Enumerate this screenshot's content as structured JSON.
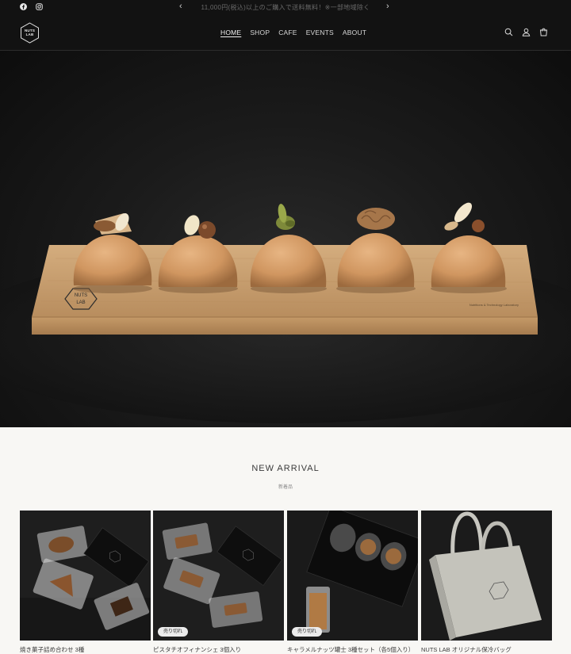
{
  "announcement": {
    "message": "11,000円(税込)以上のご購入で送料無料！※一部地域除く",
    "prev_arrow": "‹",
    "next_arrow": "›"
  },
  "social": [
    "facebook-icon",
    "instagram-icon"
  ],
  "header": {
    "logo_lines": [
      "NUTS",
      "LAB"
    ],
    "nav": [
      {
        "label": "HOME",
        "active": true
      },
      {
        "label": "SHOP",
        "active": false
      },
      {
        "label": "CAFE",
        "active": false
      },
      {
        "label": "EVENTS",
        "active": false
      },
      {
        "label": "ABOUT",
        "active": false
      }
    ],
    "icons": [
      "search-icon",
      "account-icon",
      "cart-icon"
    ]
  },
  "hero": {
    "board_brand": "NUTS LAB",
    "board_text": "Nutritions & Technology Laboratory"
  },
  "new_arrival": {
    "title": "NEW ARRIVAL",
    "subtitle": "新着品",
    "products": [
      {
        "name": "焼き菓子詰め合わせ 3種",
        "badge": ""
      },
      {
        "name": "ピスタチオフィナンシェ 3個入り",
        "badge": "売り切れ"
      },
      {
        "name": "キャラメルナッツ罐士 3種セット（各5個入り）",
        "badge": "売り切れ"
      },
      {
        "name": "NUTS LAB オリジナル保冷バッグ",
        "badge": ""
      }
    ]
  },
  "colors": {
    "header_bg": "#121212",
    "page_bg": "#f8f7f4",
    "wood": "#c49a6c"
  }
}
